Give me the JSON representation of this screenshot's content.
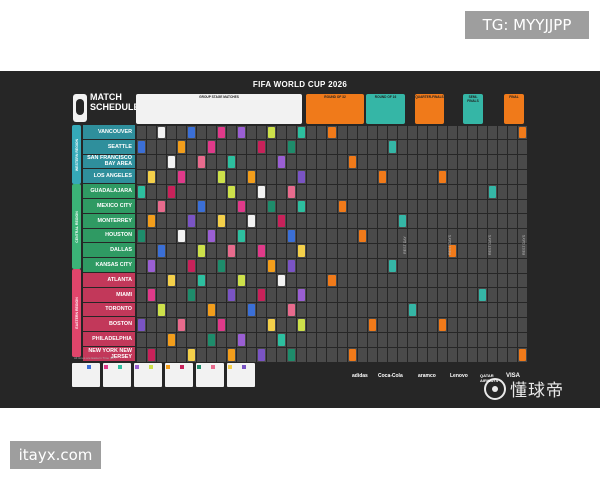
{
  "watermarks": {
    "top": "TG: MYYJJPP",
    "bottom": "itayx.com",
    "logo_text": "懂球帝"
  },
  "poster": {
    "title": "FIFA WORLD CUP 2026",
    "match_schedule": "MATCH SCHEDULE",
    "stage_headers": [
      {
        "label": "GROUP STAGE MATCHES",
        "color": "#f2f2f2"
      },
      {
        "label": "ROUND OF 32",
        "color": "#f07a1a"
      },
      {
        "label": "ROUND OF 16",
        "color": "#35b6a6"
      },
      {
        "label": "QUARTER-FINALS",
        "color": "#f07a1a"
      },
      {
        "label": "SEMI-FINALS",
        "color": "#35b6a6"
      },
      {
        "label": "FINAL",
        "color": "#f07a1a"
      }
    ],
    "regions": [
      {
        "label": "WESTERN REGION",
        "color": "#35a9b8"
      },
      {
        "label": "CENTRAL REGION",
        "color": "#3bb377"
      },
      {
        "label": "EASTERN REGION",
        "color": "#e0456b"
      }
    ],
    "cities": [
      "VANCOUVER",
      "SEATTLE",
      "SAN FRANCISCO BAY AREA",
      "LOS ANGELES",
      "GUADALAJARA",
      "MEXICO CITY",
      "MONTERREY",
      "HOUSTON",
      "DALLAS",
      "KANSAS CITY",
      "ATLANTA",
      "MIAMI",
      "TORONTO",
      "BOSTON",
      "PHILADELPHIA",
      "NEW YORK NEW JERSEY"
    ],
    "rest_label": "REST DAYS",
    "rest_label_short": "REST DAY",
    "footnote": "All times are Eastern Time (ET)",
    "sponsors": [
      "adidas",
      "Coca-Cola",
      "aramco",
      "Lenovo",
      "QATAR AIRWAYS",
      "VISA"
    ],
    "colors": {
      "background": "#262626",
      "grid_cell": "#4a4a4a",
      "group_colors": [
        "#f2f2f2",
        "#3b6fd6",
        "#e03a8a",
        "#2dbf9f",
        "#9a5fd3",
        "#cde14a",
        "#f29e1c",
        "#c8225a",
        "#1e8c6b",
        "#e86b8d",
        "#f4d04a",
        "#7a54c4"
      ]
    }
  }
}
